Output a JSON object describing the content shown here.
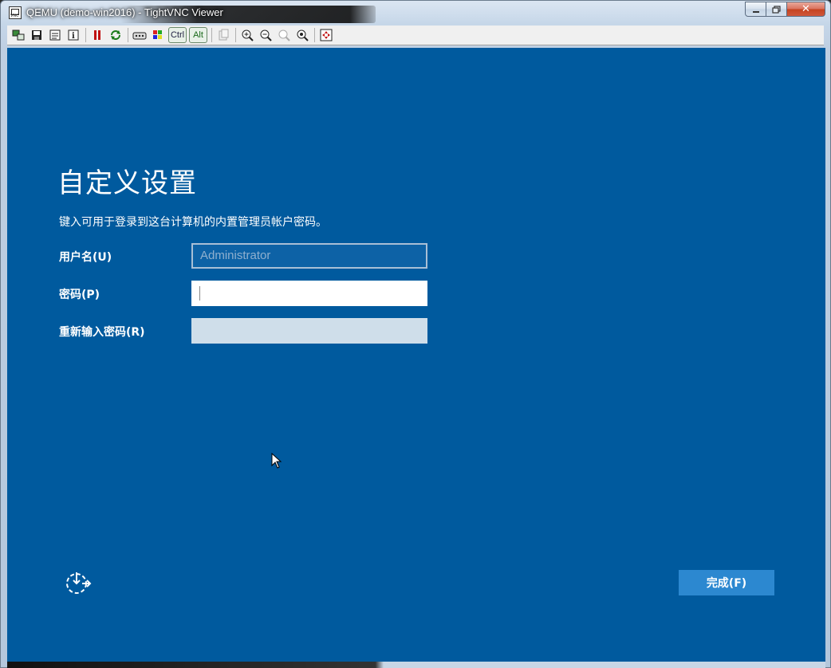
{
  "window": {
    "title": "QEMU (demo-win2016) - TightVNC Viewer",
    "minimize_icon": "minimize-icon",
    "maximize_icon": "restore-icon",
    "close_label": "✕"
  },
  "toolbar": {
    "items": [
      {
        "name": "new-connection-icon",
        "glyph": "⧉"
      },
      {
        "name": "save-icon",
        "glyph": "💾"
      },
      {
        "name": "options-icon",
        "glyph": "▤"
      },
      {
        "name": "info-icon",
        "glyph": "ℹ"
      },
      {
        "name": "pause-icon",
        "glyph": "❚❚"
      },
      {
        "name": "refresh-icon",
        "glyph": "⟳"
      },
      {
        "name": "send-ctrl-alt-del-icon",
        "glyph": "⌨"
      },
      {
        "name": "windows-key-icon",
        "glyph": "⊞"
      },
      {
        "name": "clipboard-icon",
        "glyph": "⎘"
      },
      {
        "name": "zoom-in-icon",
        "glyph": "⊕"
      },
      {
        "name": "zoom-out-icon",
        "glyph": "⊖"
      },
      {
        "name": "zoom-100-icon",
        "glyph": "◎"
      },
      {
        "name": "zoom-auto-icon",
        "glyph": "⊙"
      },
      {
        "name": "fullscreen-icon",
        "glyph": "⛶"
      }
    ],
    "ctrl_label": "Ctrl",
    "alt_label": "Alt"
  },
  "setup": {
    "heading": "自定义设置",
    "description": "键入可用于登录到这台计算机的内置管理员帐户密码。",
    "username_label": "用户名(U)",
    "username_value": "Administrator",
    "password_label": "密码(P)",
    "password_value": "",
    "reenter_label": "重新输入密码(R)",
    "reenter_value": "",
    "finish_label": "完成(F)"
  },
  "colors": {
    "screen_bg": "#005a9e",
    "finish_button": "#2c88d0"
  }
}
